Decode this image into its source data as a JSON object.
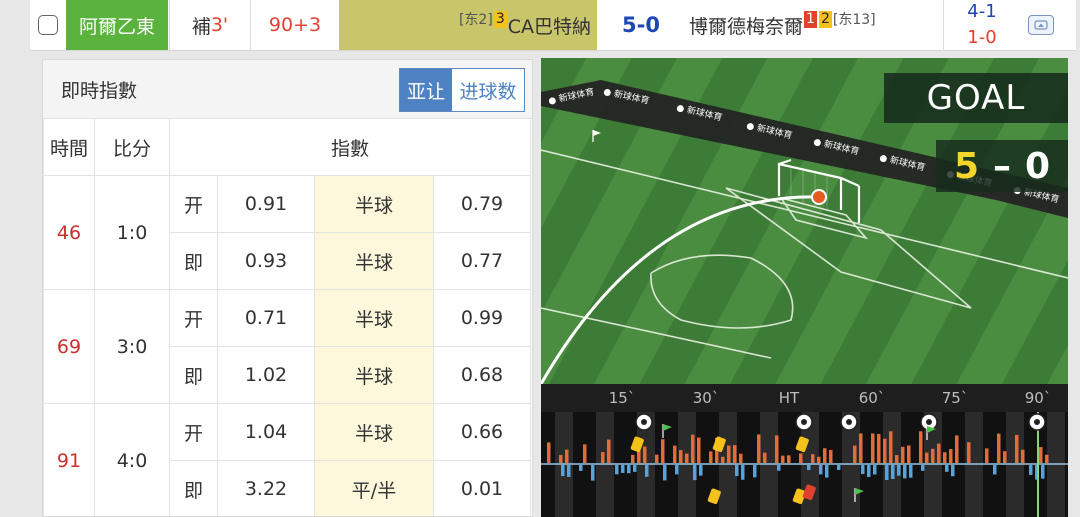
{
  "match": {
    "league": "阿爾乙東",
    "status_prefix": "補",
    "status_minute": "3'",
    "elapsed": "90+3",
    "home": {
      "rank": "[东2]",
      "yellow_cards": "3",
      "name": "CA巴特納"
    },
    "score": "5-0",
    "away": {
      "name": "博爾德梅奈爾",
      "red_cards": "1",
      "yellow_cards": "2",
      "rank": "[东13]"
    },
    "halftime_line1": "4-1",
    "halftime_line2": "1-0"
  },
  "odds": {
    "title": "即時指數",
    "tab_handicap": "亚让",
    "tab_goals": "进球数",
    "header_time": "時間",
    "header_score": "比分",
    "header_index": "指數",
    "rows": [
      {
        "minute": "46",
        "score": "1:0",
        "open": {
          "type": "开",
          "home": "0.91",
          "line": "半球",
          "away": "0.79"
        },
        "live": {
          "type": "即",
          "home": "0.93",
          "line": "半球",
          "away": "0.77"
        }
      },
      {
        "minute": "69",
        "score": "3:0",
        "open": {
          "type": "开",
          "home": "0.71",
          "line": "半球",
          "away": "0.99"
        },
        "live": {
          "type": "即",
          "home": "1.02",
          "line": "半球",
          "away": "0.68"
        }
      },
      {
        "minute": "91",
        "score": "4:0",
        "open": {
          "type": "开",
          "home": "1.04",
          "line": "半球",
          "away": "0.66"
        },
        "live": {
          "type": "即",
          "home": "3.22",
          "line": "平/半",
          "away": "0.01"
        }
      }
    ]
  },
  "animation": {
    "banner": "GOAL",
    "home_goals": "5",
    "dash": "–",
    "away_goals": "0",
    "ad_text": "新球体育",
    "timeline_ticks": [
      "15`",
      "30`",
      "HT",
      "60`",
      "75`",
      "90`"
    ]
  },
  "colors": {
    "league_bg": "#59b33d",
    "home_bg": "#c9c56b",
    "score_blue": "#1e47b4",
    "accent_red": "#e2412f",
    "pitch_dark": "#3c7a36",
    "pitch_light": "#4a8c3f",
    "home_bars": "#e56a3e",
    "away_bars": "#5aa3d8"
  }
}
